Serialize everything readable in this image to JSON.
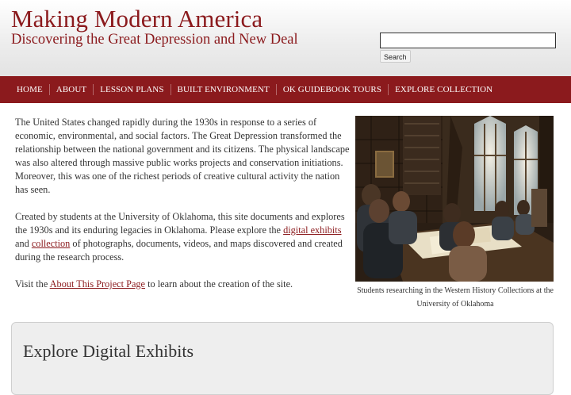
{
  "header": {
    "site_title": "Making Modern America",
    "site_subtitle": "Discovering the Great Depression and New Deal"
  },
  "search": {
    "value": "",
    "placeholder": "",
    "button_label": "Search"
  },
  "nav": {
    "items": [
      {
        "label": "HOME"
      },
      {
        "label": "ABOUT"
      },
      {
        "label": "LESSON PLANS"
      },
      {
        "label": "BUILT ENVIRONMENT"
      },
      {
        "label": "OK GUIDEBOOK TOURS"
      },
      {
        "label": "EXPLORE COLLECTION"
      }
    ]
  },
  "intro": {
    "p1": "The United States changed rapidly during the 1930s in response to a series of economic, environmental, and social factors. The Great Depression transformed the relationship between the national government and its citizens. The physical landscape was also altered through massive public works projects and conservation initiations. Moreover, this was one of the richest periods of creative cultural activity the nation has seen.",
    "p2_before": "Created by students at the University of Oklahoma, this site documents and explores the 1930s and its enduring legacies in Oklahoma. Please explore the ",
    "p2_link1": "digital exhibits",
    "p2_mid": " and ",
    "p2_link2": "collection",
    "p2_after": " of photographs, documents, videos, and maps discovered and created during the research process.",
    "p3_before": "Visit the ",
    "p3_link": "About This Project Page",
    "p3_after": " to learn about the creation of the site."
  },
  "photo": {
    "caption": "Students researching in the Western History Collections at the University of Oklahoma"
  },
  "exhibits": {
    "title": "Explore Digital Exhibits"
  },
  "colors": {
    "brand": "#8b1a1d",
    "header_bg": "#ececec",
    "text": "#333333",
    "panel_bg": "#eeeeee"
  }
}
